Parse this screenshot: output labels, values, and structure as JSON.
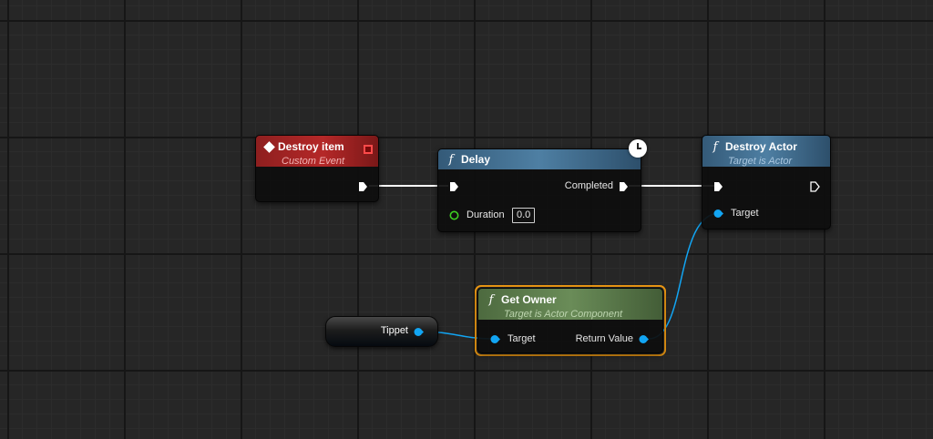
{
  "colors": {
    "event_header": "#8e1f1f",
    "function_header": "#345a78",
    "pure_function_header": "#4d6a3f",
    "exec_wire": "#ffffff",
    "object_pin": "#12a5f3",
    "float_pin": "#3ecf22",
    "selection": "#f09b14"
  },
  "nodes": {
    "custom_event": {
      "title": "Destroy item",
      "subtitle": "Custom Event",
      "icon": "event-diamond-icon"
    },
    "delay": {
      "title": "Delay",
      "icon": "function-icon",
      "completed_label": "Completed",
      "duration_label": "Duration",
      "duration_value": "0.0",
      "latent_icon": "clock-icon"
    },
    "destroy_actor": {
      "title": "Destroy Actor",
      "subtitle": "Target is Actor",
      "icon": "function-icon",
      "target_label": "Target"
    },
    "get_owner": {
      "title": "Get Owner",
      "subtitle": "Target is Actor Component",
      "icon": "function-icon",
      "target_label": "Target",
      "return_label": "Return Value",
      "selected": true
    },
    "variable": {
      "label": "Tippet"
    }
  }
}
